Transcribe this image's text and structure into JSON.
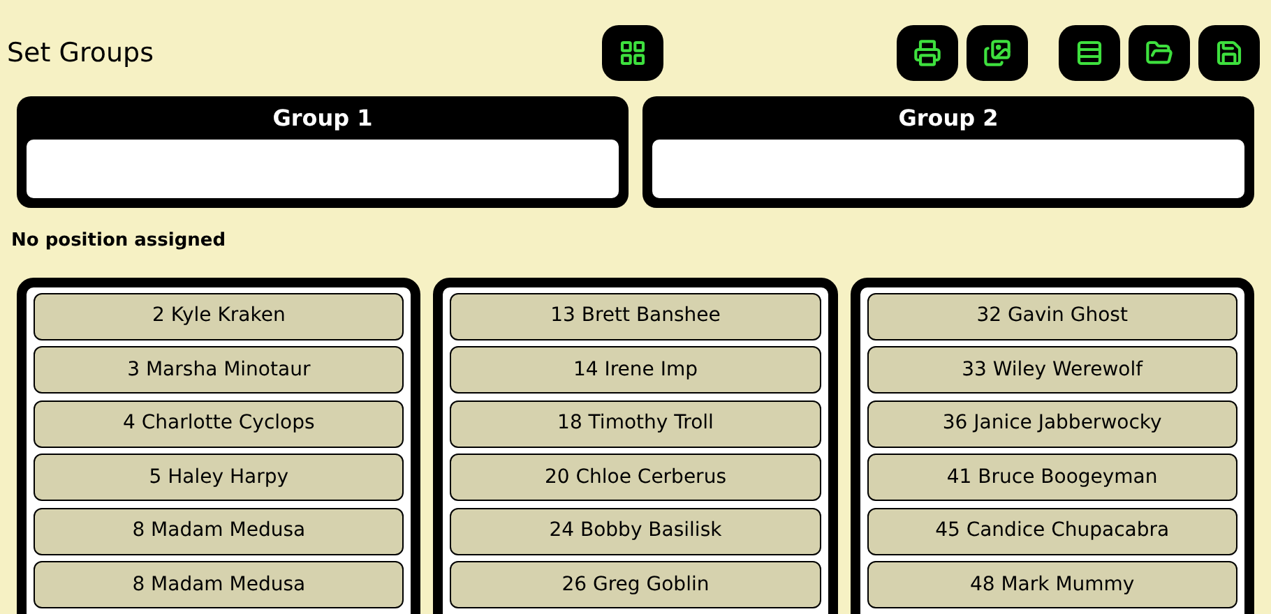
{
  "title": "Set Groups",
  "toolbar": [
    {
      "kind": "grid"
    },
    {
      "kind": "print"
    },
    {
      "kind": "images"
    },
    {
      "kind": "list"
    },
    {
      "kind": "open"
    },
    {
      "kind": "save"
    }
  ],
  "groups": [
    {
      "name": "Group 1"
    },
    {
      "name": "Group 2"
    }
  ],
  "unassigned_label": "No position assigned",
  "columns": [
    {
      "items": [
        "2 Kyle Kraken",
        "3 Marsha Minotaur",
        "4 Charlotte Cyclops",
        "5 Haley Harpy",
        "8 Madam Medusa",
        "8 Madam Medusa"
      ]
    },
    {
      "items": [
        "13 Brett Banshee",
        "14 Irene Imp",
        "18 Timothy Troll",
        "20 Chloe Cerberus",
        "24 Bobby Basilisk",
        "26 Greg Goblin"
      ]
    },
    {
      "items": [
        "32 Gavin Ghost",
        "33 Wiley Werewolf",
        "36 Janice Jabberwocky",
        "41 Bruce Boogeyman",
        "45 Candice Chupacabra",
        "48 Mark Mummy"
      ]
    }
  ]
}
